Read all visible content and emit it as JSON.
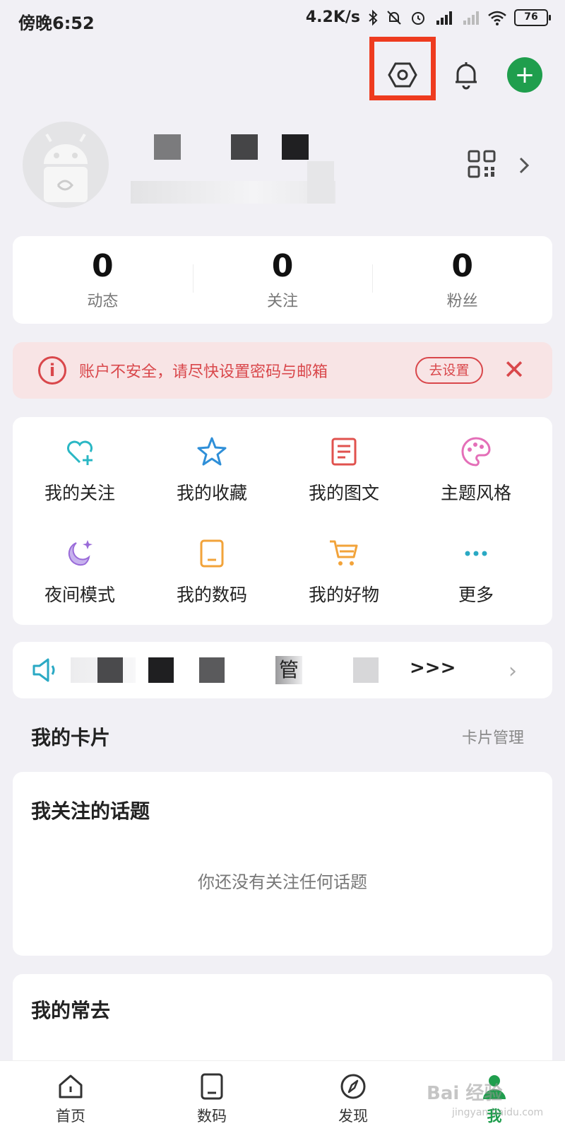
{
  "status_bar": {
    "time": "傍晚6:52",
    "speed": "4.2K/s",
    "battery": "76"
  },
  "profile": {
    "avatar": "android-avatar"
  },
  "stats": [
    {
      "value": "0",
      "label": "动态"
    },
    {
      "value": "0",
      "label": "关注"
    },
    {
      "value": "0",
      "label": "粉丝"
    }
  ],
  "warning": {
    "text": "账户不安全，请尽快设置密码与邮箱",
    "button": "去设置",
    "close": "✕"
  },
  "menu": [
    {
      "label": "我的关注",
      "icon": "heart-plus-icon",
      "color": "#2ab7c4"
    },
    {
      "label": "我的收藏",
      "icon": "star-icon",
      "color": "#2f8fd8"
    },
    {
      "label": "我的图文",
      "icon": "document-icon",
      "color": "#e0524e"
    },
    {
      "label": "主题风格",
      "icon": "palette-icon",
      "color": "#e46fb8"
    },
    {
      "label": "夜间模式",
      "icon": "moon-icon",
      "color": "#9a6bd9"
    },
    {
      "label": "我的数码",
      "icon": "tablet-icon",
      "color": "#f2a33a"
    },
    {
      "label": "我的好物",
      "icon": "cart-icon",
      "color": "#f2a33a"
    },
    {
      "label": "更多",
      "icon": "more-icon",
      "color": "#2aa9c4"
    }
  ],
  "notice": {
    "partial_text": "管",
    "arrows": ">>>",
    "chevron": "›"
  },
  "cards_section": {
    "title": "我的卡片",
    "manage": "卡片管理"
  },
  "topic_card": {
    "title": "我关注的话题",
    "empty": "你还没有关注任何话题"
  },
  "frequent_card": {
    "title": "我的常去"
  },
  "bottom_nav": [
    {
      "label": "首页"
    },
    {
      "label": "数码"
    },
    {
      "label": "发现"
    },
    {
      "label": "我"
    }
  ],
  "watermark": {
    "main": "Bai 经验",
    "sub": "jingyan.baidu.com"
  },
  "colors": {
    "accent": "#1f9e4d",
    "highlight": "#ee3b1f",
    "warning": "#d9474b"
  }
}
